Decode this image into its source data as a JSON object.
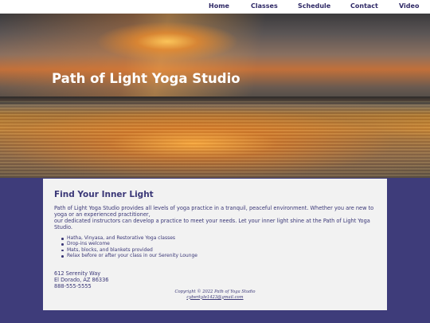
{
  "nav": {
    "items": [
      {
        "label": "Home"
      },
      {
        "label": "Classes"
      },
      {
        "label": "Schedule"
      },
      {
        "label": "Contact"
      },
      {
        "label": "Video"
      }
    ]
  },
  "hero": {
    "title": "Path of Light Yoga Studio"
  },
  "main": {
    "heading": "Find Your Inner Light",
    "intro_line1": "Path of Light Yoga Studio provides all levels of yoga practice in a tranquil, peaceful environment. Whether you are new to yoga or an experienced practitioner,",
    "intro_line2": "our dedicated instructors can develop a practice to meet your needs. Let your inner light shine at the Path of Light Yoga Studio.",
    "features": [
      "Hatha, Vinyasa, and Restorative Yoga classes",
      "Drop-ins welcome",
      "Mats, blocks, and blankets provided",
      "Relax before or after your class in our Serenity Lounge"
    ],
    "address": {
      "street": "612 Serenity Way",
      "city": "El Dorado, AZ 86336",
      "phone": "888-555-5555"
    }
  },
  "footer": {
    "copyright": "Copyright © 2022 Path of Yoga Studio",
    "email": "cyberkyle1423@gmail.com"
  },
  "colors": {
    "background": "#3e3c7a",
    "text": "#3a3777",
    "nav_text": "#2f2966",
    "card": "#f2f2f2"
  }
}
